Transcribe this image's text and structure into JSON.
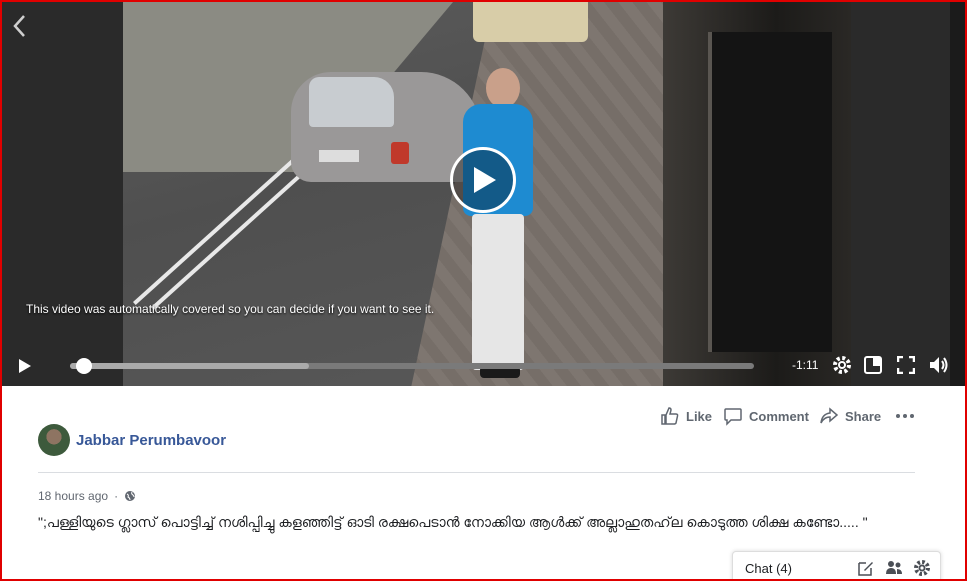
{
  "video": {
    "cover_notice": "This video was automatically covered so you can decide if you want to see it.",
    "time_remaining": "-1:11",
    "progress": 0.02,
    "buffered": 0.35
  },
  "actions": {
    "like_label": "Like",
    "comment_label": "Comment",
    "share_label": "Share"
  },
  "post": {
    "author": "Jabbar Perumbavoor",
    "timestamp": "18 hours ago",
    "privacy_icon": "globe-icon",
    "text": "\";പള്ളിയുടെ ഗ്ലാസ് പൊട്ടിച്ച് നശിപ്പിച്ചു കളഞ്ഞിട്ട് ഓടി രക്ഷപെടാൻ നോക്കിയ ആൾക്ക് അല്ലാഹുതഹ്‌ല കൊടുത്ത ശിക്ഷ കണ്ടോ..... \""
  },
  "chat": {
    "label": "Chat (4)"
  },
  "colors": {
    "frame_border": "#e00000",
    "author_link": "#385898",
    "action_text": "#606770"
  }
}
